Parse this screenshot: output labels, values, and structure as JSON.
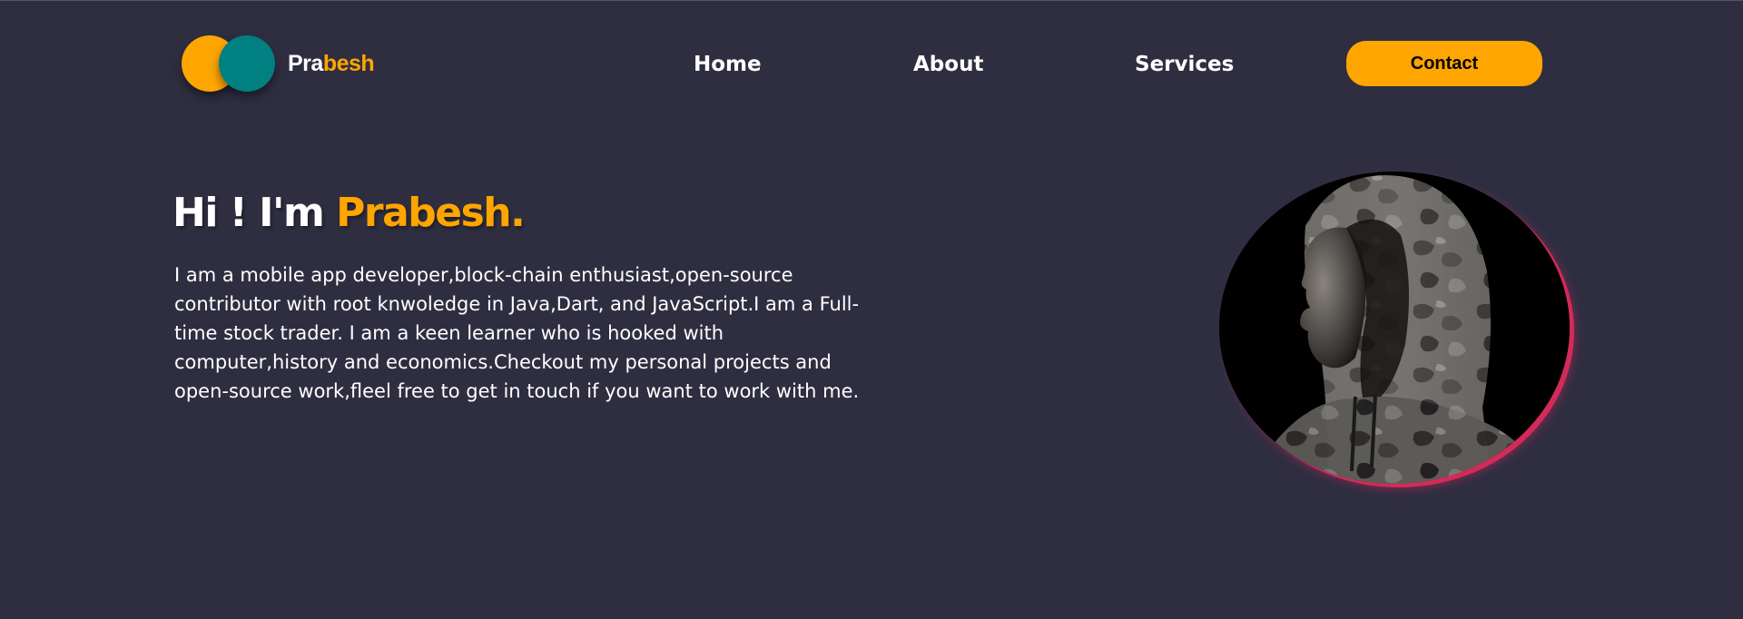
{
  "header": {
    "logo": {
      "text_part_a": "Pra",
      "text_part_b": "besh",
      "circle_colors": [
        "#ffa500",
        "#008080"
      ]
    },
    "nav": {
      "home": "Home",
      "about": "About",
      "services": "Services"
    },
    "contact_label": "Contact"
  },
  "hero": {
    "greeting": "Hi ! I'm ",
    "name": "Prabesh.",
    "bio": "I am a mobile app developer,block-chain enthusiast,open-source contributor with root knwoledge in Java,Dart, and JavaScript.I am a Full-time stock trader. I am a keen learner who is hooked with computer,history and economics.Checkout my personal projects and open-source work,fleel free to get in touch if you want to work with me.",
    "portrait": {
      "subject": "person-in-camouflage-hoodie",
      "border_color": "#d42a5a"
    }
  },
  "theme": {
    "background": "#2f2e41",
    "accent": "#ffa500",
    "secondary": "#008080",
    "text": "#ffffff"
  }
}
